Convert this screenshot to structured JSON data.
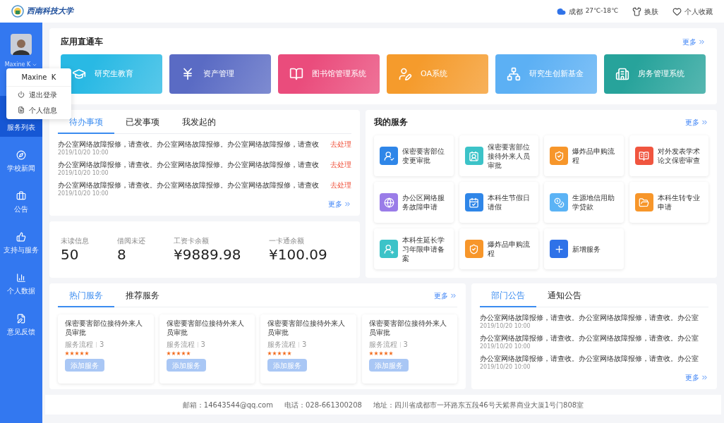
{
  "header": {
    "logo_text": "西南科技大学",
    "weather": {
      "city": "成都",
      "temp": "27℃-18℃"
    },
    "links": [
      "换肤",
      "个人收藏"
    ]
  },
  "sidebar": {
    "user": "Maxine K",
    "items": [
      {
        "label": "服务列表",
        "selected": true
      },
      {
        "label": "学校新闻",
        "selected": false
      },
      {
        "label": "公告",
        "selected": false
      },
      {
        "label": "支持与服务",
        "selected": false
      },
      {
        "label": "个人数据",
        "selected": false
      },
      {
        "label": "意见反馈",
        "selected": false
      }
    ]
  },
  "user_menu": {
    "name": "Maxine  K",
    "items": [
      "退出登录",
      "个人信息"
    ]
  },
  "apps": {
    "title": "应用直通车",
    "more": "更多",
    "items": [
      {
        "label": "研究生教育",
        "color": "#29b9e4"
      },
      {
        "label": "资产管理",
        "color": "#5a6bc4"
      },
      {
        "label": "图书馆管理系统",
        "color": "#ea4c7c"
      },
      {
        "label": "OA系统",
        "color": "#f59b2c"
      },
      {
        "label": "研究生创新基金",
        "color": "#5cb0f4"
      },
      {
        "label": "房务管理系统",
        "color": "#27a39b"
      }
    ]
  },
  "todo": {
    "tabs": [
      {
        "label": "待办事项",
        "selected": true
      },
      {
        "label": "已发事项",
        "selected": false
      },
      {
        "label": "我发起的",
        "selected": false
      }
    ],
    "rows": [
      {
        "title": "办公室网络故障报修，请查收。办公室网络故障报修。办公室网络故障报修，请查收",
        "time": "2019/10/20 10:00",
        "action": "去处理"
      },
      {
        "title": "办公室网络故障报修，请查收。办公室网络故障报修。办公室网络故障报修，请查收",
        "time": "2019/10/20 10:00",
        "action": "去处理"
      },
      {
        "title": "办公室网络故障报修，请查收。办公室网络故障报修。办公室网络故障报修，请查收",
        "time": "2019/10/20 10:00",
        "action": "去处理"
      }
    ],
    "more": "更多"
  },
  "stats": [
    {
      "label": "未读信息",
      "value": "50"
    },
    {
      "label": "借阅未还",
      "value": "8"
    },
    {
      "label": "工资卡余额",
      "value": "¥9889.98"
    },
    {
      "label": "一卡通余额",
      "value": "¥100.09"
    }
  ],
  "my_services": {
    "title": "我的服务",
    "more": "更多",
    "items": [
      {
        "label": "保密要害部位变更审批",
        "color": "#2f86e8"
      },
      {
        "label": "保密要害部位接待外来人员审批",
        "color": "#3cc3c8"
      },
      {
        "label": "爆炸品申购流程",
        "color": "#f7962a"
      },
      {
        "label": "对外发表学术论文保密审查",
        "color": "#f0553f"
      },
      {
        "label": "办公区网络服务故障申请",
        "color": "#9a7ce8"
      },
      {
        "label": "本科生节假日请假",
        "color": "#2f86e8"
      },
      {
        "label": "生源地信用助学贷款",
        "color": "#5bb3f5"
      },
      {
        "label": "本科生转专业申请",
        "color": "#f7962a"
      },
      {
        "label": "本科生延长学习年限申请备案",
        "color": "#3cc3c8"
      },
      {
        "label": "爆炸品申购流程",
        "color": "#f7962a"
      },
      {
        "label": "新增服务",
        "color": "#2f72e8"
      }
    ]
  },
  "hot": {
    "tabs": [
      {
        "label": "热门服务",
        "selected": true
      },
      {
        "label": "推荐服务",
        "selected": false
      }
    ],
    "more": "更多",
    "cards": [
      {
        "title": "保密要害部位接待外来人员审批",
        "meta": "服务流程",
        "count": "3",
        "stars": 5,
        "button": "添加服务"
      },
      {
        "title": "保密要害部位接待外来人员审批",
        "meta": "服务流程",
        "count": "3",
        "stars": 5,
        "button": "添加服务"
      },
      {
        "title": "保密要害部位接待外来人员审批",
        "meta": "服务流程",
        "count": "3",
        "stars": 5,
        "button": "添加服务"
      },
      {
        "title": "保密要害部位接待外来人员审批",
        "meta": "服务流程",
        "count": "3",
        "stars": 5,
        "button": "添加服务"
      }
    ]
  },
  "notices": {
    "tabs": [
      {
        "label": "部门公告",
        "selected": true
      },
      {
        "label": "通知公告",
        "selected": false
      }
    ],
    "rows": [
      {
        "title": "办公室网络故障报修，请查收。办公室网络故障报修，请查收。办公室",
        "time": "2019/10/20 10:00"
      },
      {
        "title": "办公室网络故障报修，请查收。办公室网络故障报修，请查收。办公室",
        "time": "2019/10/20 10:00"
      },
      {
        "title": "办公室网络故障报修，请查收。办公室网络故障报修，请查收。办公室",
        "time": "2019/10/20 10:00"
      }
    ],
    "more": "更多"
  },
  "footer": [
    "邮箱：14643544@qq.com",
    "电话：028-661300208",
    "地址：四川省成都市一环路东五段46号天紫界商业大厦1号门808室"
  ]
}
